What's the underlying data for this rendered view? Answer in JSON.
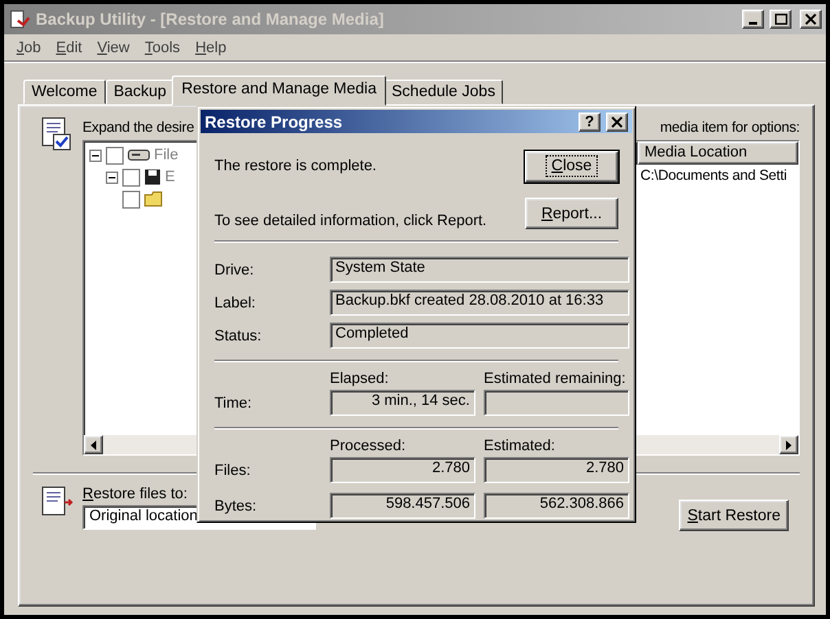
{
  "window": {
    "title": "Backup Utility - [Restore and Manage Media]"
  },
  "menu": [
    "Job",
    "Edit",
    "View",
    "Tools",
    "Help"
  ],
  "tabs": [
    {
      "label": "Welcome",
      "selected": false
    },
    {
      "label": "Backup",
      "selected": false
    },
    {
      "label": "Restore and Manage Media",
      "selected": true
    },
    {
      "label": "Schedule Jobs",
      "selected": false
    }
  ],
  "restore_panel": {
    "instruction_start": "Expand the desire",
    "instruction_end": "media item for options:",
    "tree": [
      {
        "kind": "drive",
        "label": "File",
        "checked": false,
        "expanded": true,
        "children": [
          {
            "kind": "media",
            "label": "E",
            "checked": false,
            "expanded": true,
            "children": [
              {
                "kind": "set",
                "checked": false
              }
            ]
          }
        ]
      }
    ],
    "list": {
      "columns": [
        "Media Location"
      ],
      "rows": [
        [
          "C:\\Documents and Setti"
        ]
      ]
    },
    "restore_to": {
      "label": "Restore files to:",
      "value": "Original location"
    },
    "start_button": "Start Restore"
  },
  "dialog": {
    "title": "Restore Progress",
    "help": "?",
    "message": "The restore is complete.",
    "hint": "To see detailed information, click Report.",
    "buttons": [
      {
        "label": "Close",
        "default": true
      },
      {
        "label": "Report...",
        "default": false
      }
    ],
    "details": [
      {
        "label": "Drive:",
        "value": "System State"
      },
      {
        "label": "Label:",
        "value": "Backup.bkf created 28.08.2010 at 16:33"
      },
      {
        "label": "Status:",
        "value": "Completed"
      }
    ],
    "sections": [
      {
        "columns": [
          "Elapsed:",
          "Estimated remaining:"
        ],
        "rows": [
          {
            "label": "Time:",
            "values": [
              "3 min., 14 sec."
            ]
          }
        ]
      },
      {
        "columns": [
          "Processed:",
          "Estimated:"
        ],
        "rows": [
          {
            "label": "Files:",
            "values": [
              "2.780",
              "2.780"
            ]
          },
          {
            "label": "Bytes:",
            "values": [
              "598.457.506",
              "562.308.866"
            ]
          }
        ]
      }
    ]
  }
}
